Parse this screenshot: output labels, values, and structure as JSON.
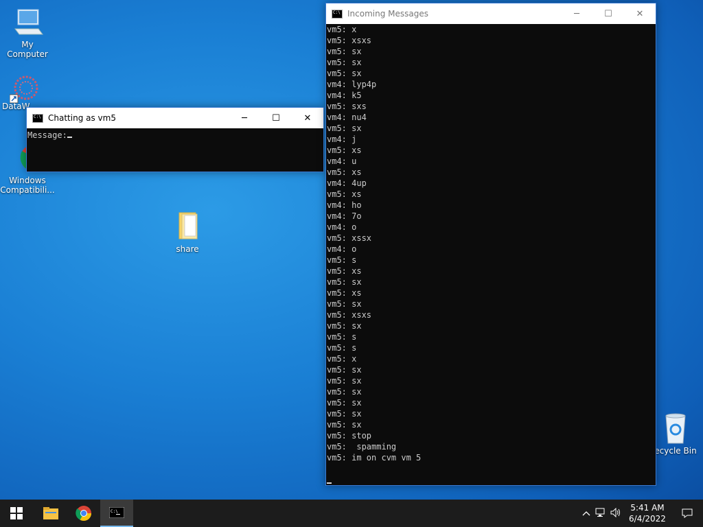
{
  "desktop": {
    "icons": [
      {
        "label": "My Computer"
      },
      {
        "label": "DataW"
      },
      {
        "label": "Windows Compatibili..."
      },
      {
        "label": "share"
      },
      {
        "label": "ecycle Bin"
      }
    ]
  },
  "chat_window": {
    "title": "Chatting as vm5",
    "prompt": "Message:",
    "controls": {
      "minimize": "─",
      "maximize": "☐",
      "close": "✕"
    }
  },
  "incoming_window": {
    "title": "Incoming Messages",
    "controls": {
      "minimize": "─",
      "maximize": "☐",
      "close": "✕"
    },
    "lines": [
      "vm5: x",
      "vm5: xsxs",
      "vm5: sx",
      "vm5: sx",
      "vm5: sx",
      "vm4: lyp4p",
      "vm4: k5",
      "vm5: sxs",
      "vm4: nu4",
      "vm5: sx",
      "vm4: j",
      "vm5: xs",
      "vm4: u",
      "vm5: xs",
      "vm4: 4up",
      "vm5: xs",
      "vm4: ho",
      "vm4: 7o",
      "vm4: o",
      "vm5: xssx",
      "vm4: o",
      "vm5: s",
      "vm5: xs",
      "vm5: sx",
      "vm5: xs",
      "vm5: sx",
      "vm5: xsxs",
      "vm5: sx",
      "vm5: s",
      "vm5: s",
      "vm5: x",
      "vm5: sx",
      "vm5: sx",
      "vm5: sx",
      "vm5: sx",
      "vm5: sx",
      "vm5: sx",
      "vm5: stop",
      "vm5:  spamming",
      "vm5: im on cvm vm 5"
    ]
  },
  "taskbar": {
    "clock_time": "5:41 AM",
    "clock_date": "6/4/2022"
  }
}
